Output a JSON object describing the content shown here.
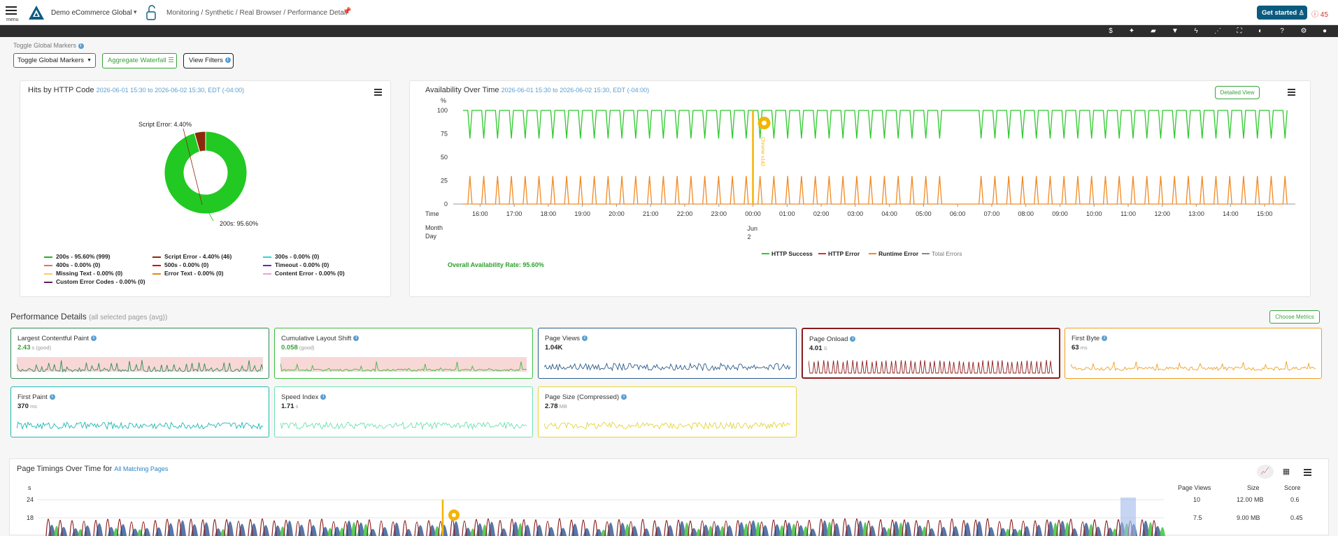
{
  "header": {
    "menu_label": "menu",
    "app_name": "Demo eCommerce Global",
    "breadcrumb": "Monitoring / Synthetic / Real Browser / Performance Detail",
    "get_started": "Get started",
    "alert_count": "45"
  },
  "toolbar_icons": [
    "dollar-icon",
    "sparkle-icon",
    "comment-icon",
    "filter-icon",
    "bolt-icon",
    "share-icon",
    "fullscreen-icon",
    "contrast-icon",
    "help-icon",
    "settings-icon",
    "user-icon"
  ],
  "controls": {
    "global_markers_label": "Toggle Global Markers",
    "global_markers_select": "Toggle Global Markers",
    "aggregate_waterfall": "Aggregate Waterfall",
    "view_filters": "View Filters"
  },
  "http_panel": {
    "title": "Hits by HTTP Code",
    "date_range": "2026-06-01 15:30 to 2026-06-02 15:30, EDT (-04:00)",
    "label_error": "Script Error: 4.40%",
    "label_success": "200s: 95.60%",
    "legend": [
      {
        "label": "200s - 95.60% (999)",
        "color": "#22b322"
      },
      {
        "label": "Script Error - 4.40% (46)",
        "color": "#8b2a0a"
      },
      {
        "label": "300s - 0.00% (0)",
        "color": "#2ad6d6"
      },
      {
        "label": "400s - 0.00% (0)",
        "color": "#e86b6b"
      },
      {
        "label": "500s - 0.00% (0)",
        "color": "#c81414"
      },
      {
        "label": "Timeout - 0.00% (0)",
        "color": "#6a22c9"
      },
      {
        "label": "Missing Text - 0.00% (0)",
        "color": "#f2d25a"
      },
      {
        "label": "Error Text - 0.00% (0)",
        "color": "#e08b14"
      },
      {
        "label": "Content Error - 0.00% (0)",
        "color": "#e8a2d9"
      },
      {
        "label": "Custom Error Codes - 0.00% (0)",
        "color": "#6a1a5a"
      }
    ],
    "chart_data": {
      "type": "pie",
      "slices": [
        {
          "label": "200s",
          "value": 95.6,
          "color": "#22c922"
        },
        {
          "label": "Script Error",
          "value": 4.4,
          "color": "#8b2a0a"
        }
      ]
    }
  },
  "availability_panel": {
    "title": "Availability Over Time",
    "date_range": "2026-06-01 15:30 to 2026-06-02 15:30, EDT (-04:00)",
    "detailed_view": "Detailed View",
    "y_unit": "%",
    "y_ticks": [
      "100",
      "75",
      "50",
      "25",
      "0"
    ],
    "x_label": "Time",
    "x_ticks": [
      "16:00",
      "17:00",
      "18:00",
      "19:00",
      "20:00",
      "21:00",
      "22:00",
      "23:00",
      "00:00",
      "01:00",
      "02:00",
      "03:00",
      "04:00",
      "05:00",
      "06:00",
      "07:00",
      "08:00",
      "09:00",
      "10:00",
      "11:00",
      "12:00",
      "13:00",
      "14:00",
      "15:00"
    ],
    "month_label": "Month",
    "day_label": "Day",
    "month_value": "Jun",
    "day_value": "2",
    "marker_label": "Chrome v142",
    "overall_rate": "Overall Availability Rate: 95.60%",
    "legend": [
      {
        "label": "HTTP Success",
        "color": "#2ec92e"
      },
      {
        "label": "HTTP Error",
        "color": "#d9322b"
      },
      {
        "label": "Runtime Error",
        "color": "#f08a24"
      },
      {
        "label": "Total Errors",
        "color": "#888888"
      }
    ],
    "chart_data": {
      "type": "line",
      "ylim": [
        0,
        100
      ],
      "series": [
        {
          "name": "HTTP Success",
          "pattern": "periodic dips to ~70 roughly every 25 minutes, otherwise 100"
        },
        {
          "name": "Runtime Error",
          "pattern": "periodic spikes to ~30 roughly every 25 minutes, otherwise 0"
        }
      ]
    }
  },
  "performance": {
    "title": "Performance Details",
    "subtitle": "(all selected pages (avg))",
    "choose_metrics": "Choose Metrics",
    "cards": [
      {
        "title": "Largest Contentful Paint",
        "value": "2.43",
        "unit": "s (good)",
        "color": "#2e8b57"
      },
      {
        "title": "Cumulative Layout Shift",
        "value": "0.058",
        "unit": "(good)",
        "color": "#3bbd3b"
      },
      {
        "title": "Page Views",
        "value": "1.04K",
        "unit": "",
        "color": "#2a5b8a"
      },
      {
        "title": "Page Onload",
        "value": "4.01",
        "unit": "S",
        "color": "#8a1c1c"
      },
      {
        "title": "First Byte",
        "value": "63",
        "unit": "ms",
        "color": "#f0a020"
      },
      {
        "title": "First Paint",
        "value": "370",
        "unit": "ms",
        "color": "#1cb8b0"
      },
      {
        "title": "Speed Index",
        "value": "1.71",
        "unit": "s",
        "color": "#6be2b0"
      },
      {
        "title": "Page Size (Compressed)",
        "value": "2.78",
        "unit": "MB",
        "color": "#e3d43a"
      }
    ]
  },
  "timings_panel": {
    "title": "Page Timings Over Time for",
    "scope_link": "All Matching Pages",
    "y_unit": "s",
    "y_ticks": [
      "24",
      "18"
    ],
    "right_headers": [
      "Page Views",
      "Size",
      "Score"
    ],
    "right_rows": [
      [
        "10",
        "12.00 MB",
        "0.6"
      ],
      [
        "7.5",
        "9.00 MB",
        "0.45"
      ]
    ]
  }
}
